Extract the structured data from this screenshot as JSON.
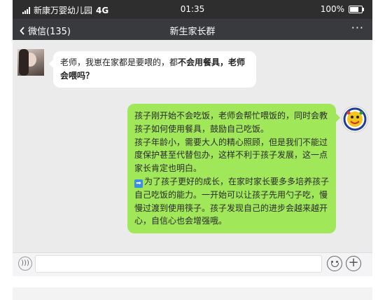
{
  "status_bar": {
    "carrier": "新康万婴幼儿园",
    "network": "4G",
    "time": "01:35",
    "battery": "100%"
  },
  "nav": {
    "back_label": "微信(135)",
    "title": "新生家长群",
    "more_label": "···"
  },
  "messages": [
    {
      "side": "left",
      "text_plain": "老师，我崽在家都是要喂的，都",
      "text_bold": "不会用餐具，老师会喂吗？"
    },
    {
      "side": "right",
      "paragraph1": "孩子刚开始不会吃饭，老师会帮忙喂饭的，同时会教孩子如何使用餐具，鼓励自己吃饭。",
      "paragraph2": "孩子年龄小，需要大人的精心照顾，但是我们不能过度保护甚至代替包办，这样不利于孩子发展，这一点家长肯定也明白。",
      "paragraph3": "为了孩子更好的成长，在家时家长要多多培养孩子自己吃饭的能力。一开始可以让孩子先用勺子吃，慢慢过渡到使用筷子。孩子发现自己的进步会越来越开心，自信心也会增强哦。"
    }
  ],
  "icons": {
    "voice": "voice-icon",
    "emoji": "emoji-icon",
    "plus": "plus-icon",
    "arrow": "right-arrow-emoji-icon"
  },
  "colors": {
    "status_bg": "#2e2e2e",
    "nav_bg": "#393a3e",
    "chat_bg": "#ebebeb",
    "bubble_out": "#a0e75a",
    "bubble_in": "#ffffff"
  }
}
